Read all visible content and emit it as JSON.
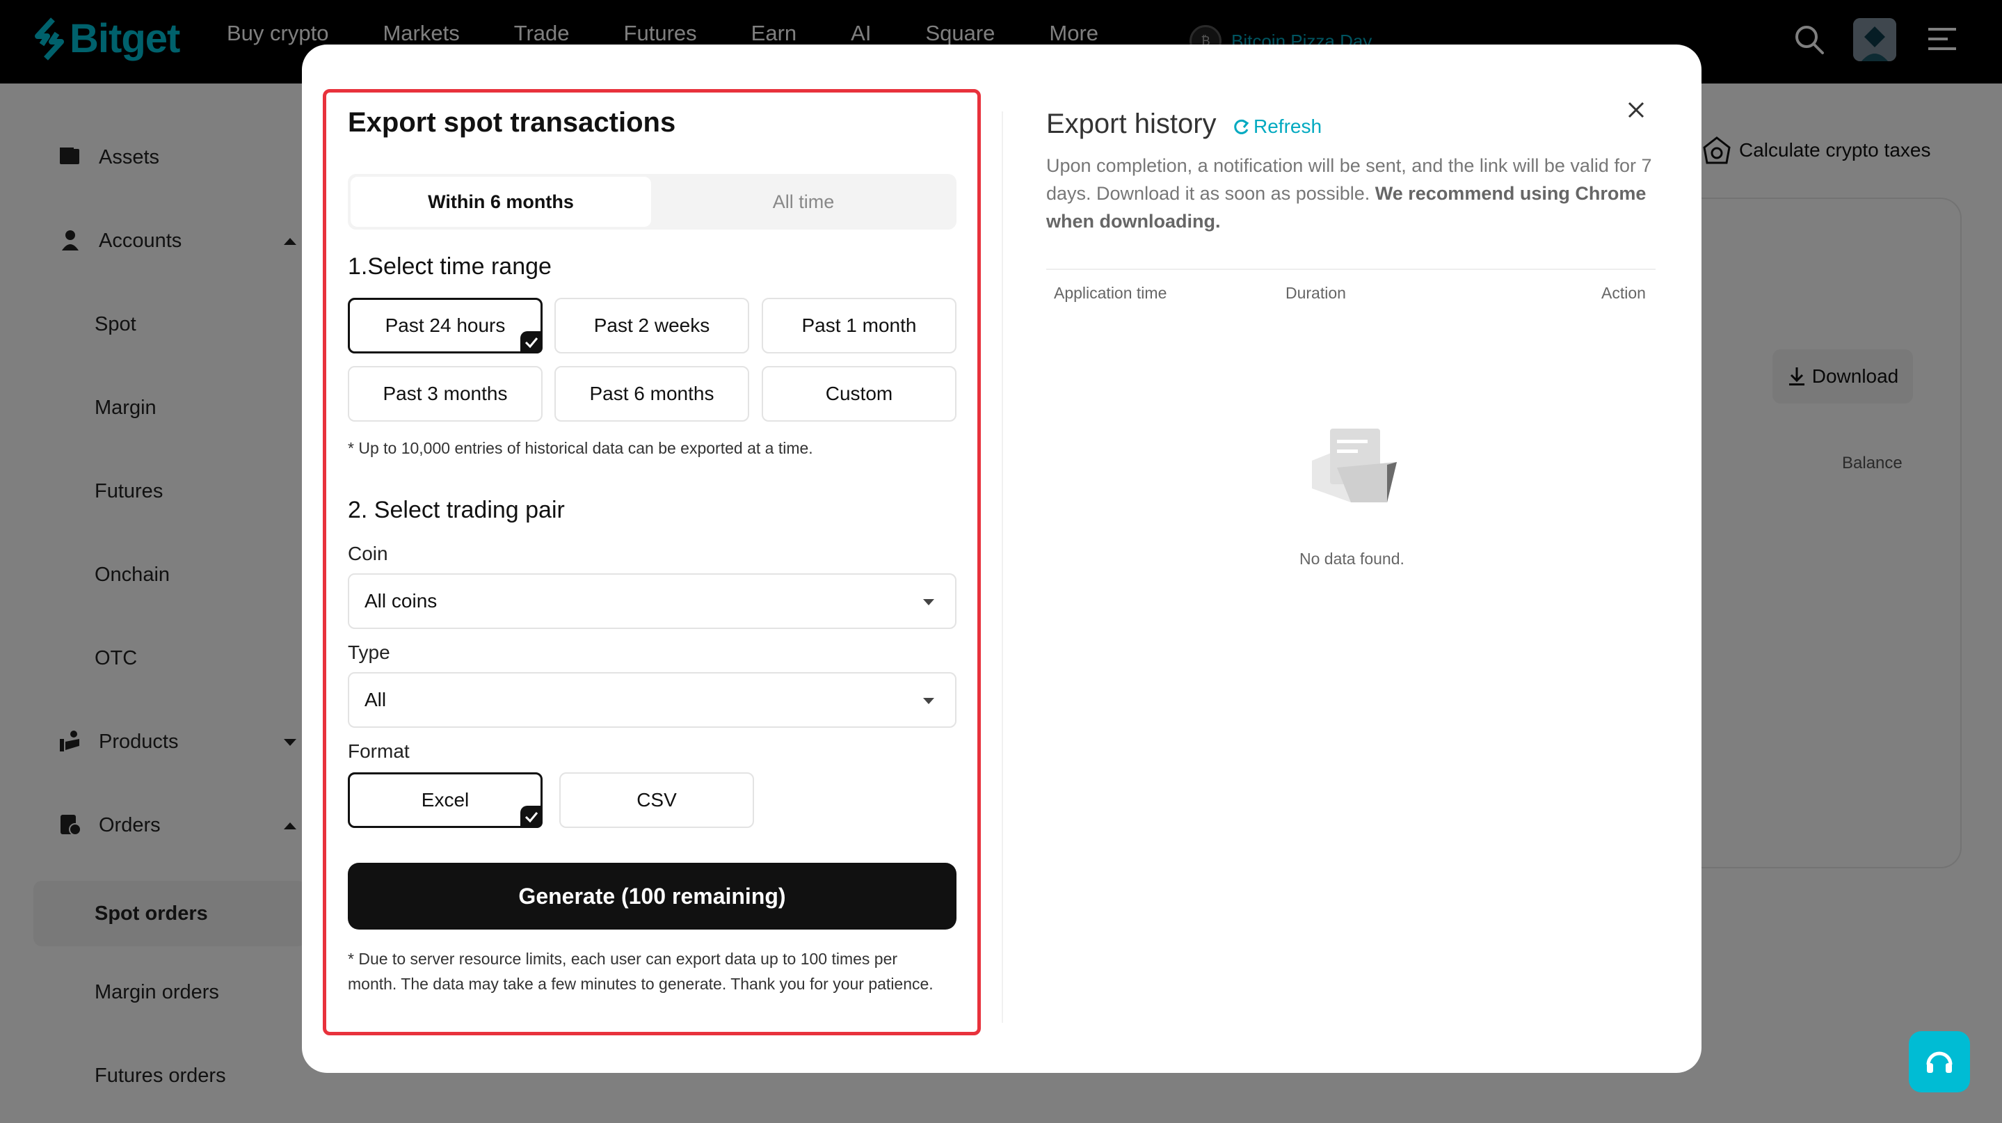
{
  "nav": {
    "brand": "Bitget",
    "items": [
      "Buy crypto",
      "Markets",
      "Trade",
      "Futures",
      "Earn",
      "AI",
      "Square",
      "More"
    ],
    "promo": "Bitcoin Pizza Day",
    "promo_coin": "₿"
  },
  "sidebar": {
    "assets": "Assets",
    "accounts": "Accounts",
    "spot": "Spot",
    "margin": "Margin",
    "futures": "Futures",
    "onchain": "Onchain",
    "otc": "OTC",
    "products": "Products",
    "orders": "Orders",
    "spot_orders": "Spot orders",
    "margin_orders": "Margin orders",
    "futures_orders": "Futures orders"
  },
  "background": {
    "tax_button": "Calculate crypto taxes",
    "download_button": "Download",
    "balance_header": "Balance"
  },
  "export": {
    "title": "Export spot transactions",
    "tabs": {
      "within": "Within 6 months",
      "all": "All time"
    },
    "section1": "1.Select time range",
    "ranges": [
      "Past 24 hours",
      "Past 2 weeks",
      "Past 1 month",
      "Past 3 months",
      "Past 6 months",
      "Custom"
    ],
    "range_note": "* Up to 10,000 entries of historical data can be exported at a time.",
    "section2": "2. Select trading pair",
    "coin_label": "Coin",
    "coin_value": "All coins",
    "type_label": "Type",
    "type_value": "All",
    "format_label": "Format",
    "formats": [
      "Excel",
      "CSV"
    ],
    "generate": "Generate (100 remaining)",
    "footer_note": "* Due to server resource limits, each user can export data up to 100 times per month. The data may take a few minutes to generate. Thank you for your patience."
  },
  "history": {
    "title": "Export history",
    "refresh": "Refresh",
    "desc_plain": "Upon completion, a notification will be sent, and the link will be valid for 7 days. Download it as soon as possible. ",
    "desc_bold": "We recommend using Chrome when downloading.",
    "columns": [
      "Application time",
      "Duration",
      "Action"
    ],
    "empty": "No data found."
  },
  "colors": {
    "accent": "#00a9c0",
    "highlight": "#e8323c"
  }
}
